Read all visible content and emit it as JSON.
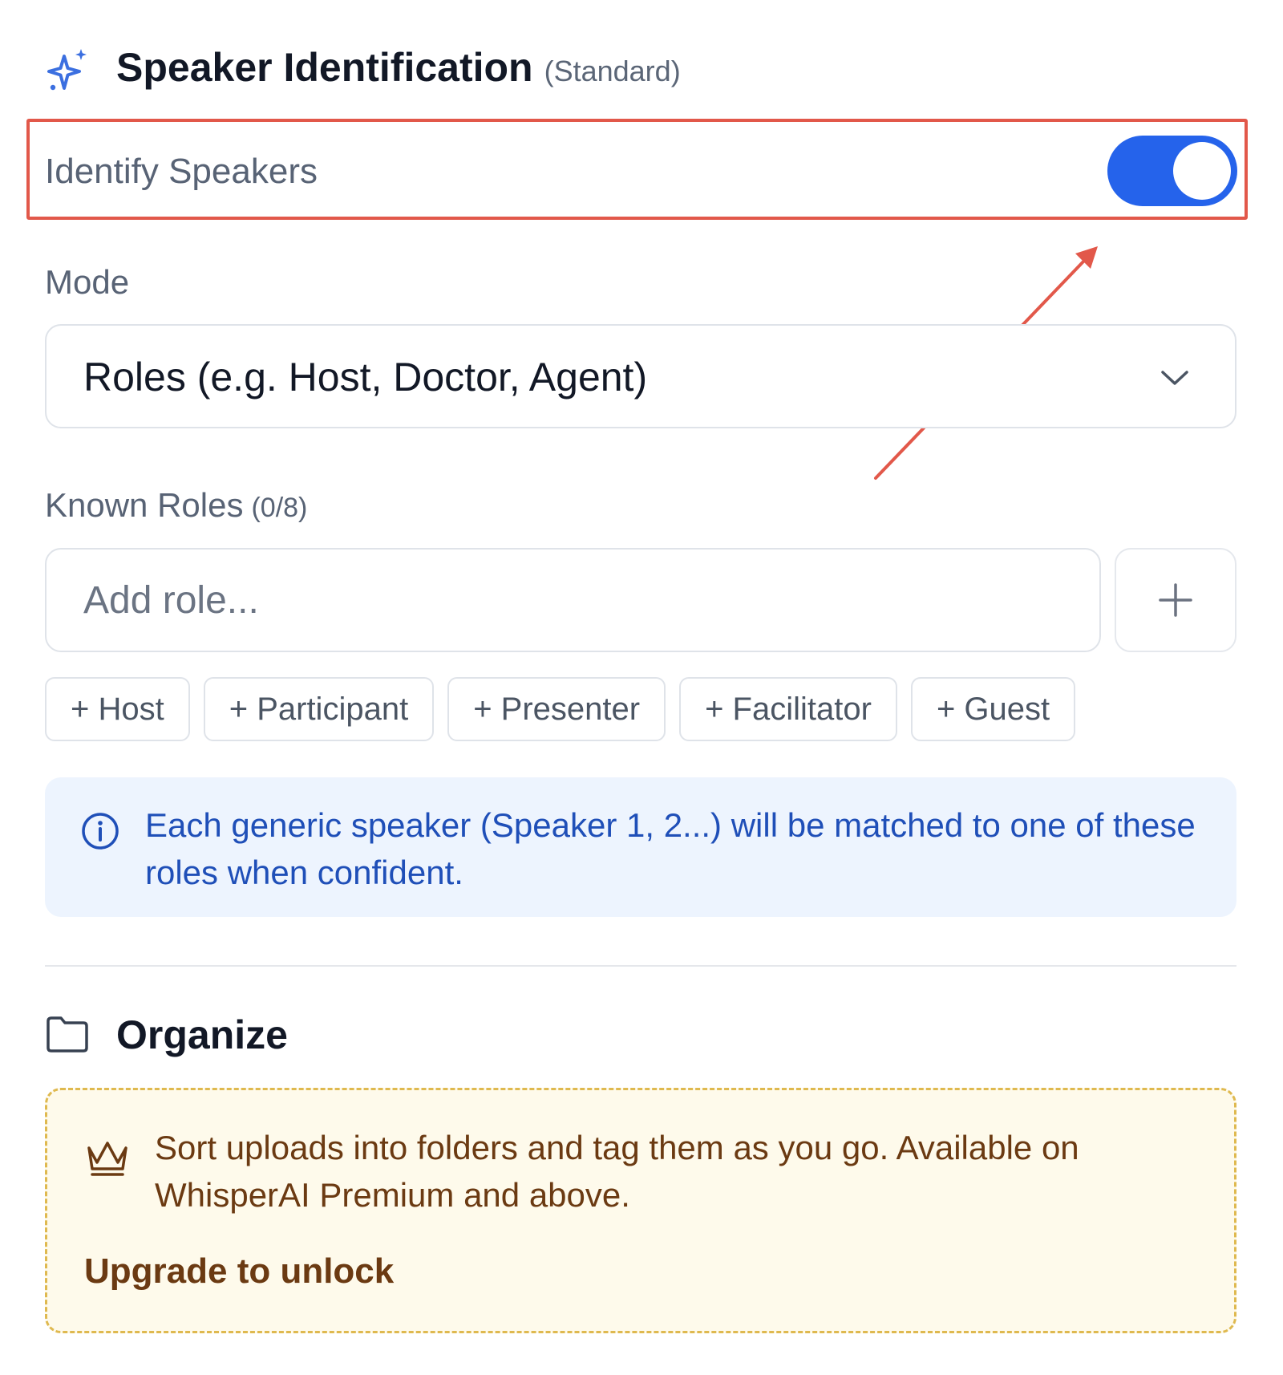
{
  "speaker_section": {
    "icon": "sparkles-icon",
    "title": "Speaker Identification",
    "badge": "(Standard)"
  },
  "identify_toggle": {
    "label": "Identify Speakers",
    "enabled": true,
    "accent_color": "#2563eb"
  },
  "mode": {
    "label": "Mode",
    "selected": "Roles (e.g. Host, Doctor, Agent)",
    "icon": "chevron-down-icon"
  },
  "known_roles": {
    "label": "Known Roles",
    "count": "(0/8)",
    "input_placeholder": "Add role...",
    "add_icon": "plus-icon",
    "suggestions": [
      "+ Host",
      "+ Participant",
      "+ Presenter",
      "+ Facilitator",
      "+ Guest"
    ]
  },
  "info_banner": {
    "icon": "info-icon",
    "text": "Each generic speaker (Speaker 1, 2...) will be matched to one of these roles when confident.",
    "color": "#1f4fb8"
  },
  "organize_section": {
    "icon": "folder-icon",
    "title": "Organize",
    "premium": {
      "icon": "crown-icon",
      "text": "Sort uploads into folders and tag them as you go. Available on WhisperAI Premium and above.",
      "link": "Upgrade to unlock",
      "color": "#6b3a12"
    }
  },
  "annotation": {
    "color": "#e2584a"
  }
}
